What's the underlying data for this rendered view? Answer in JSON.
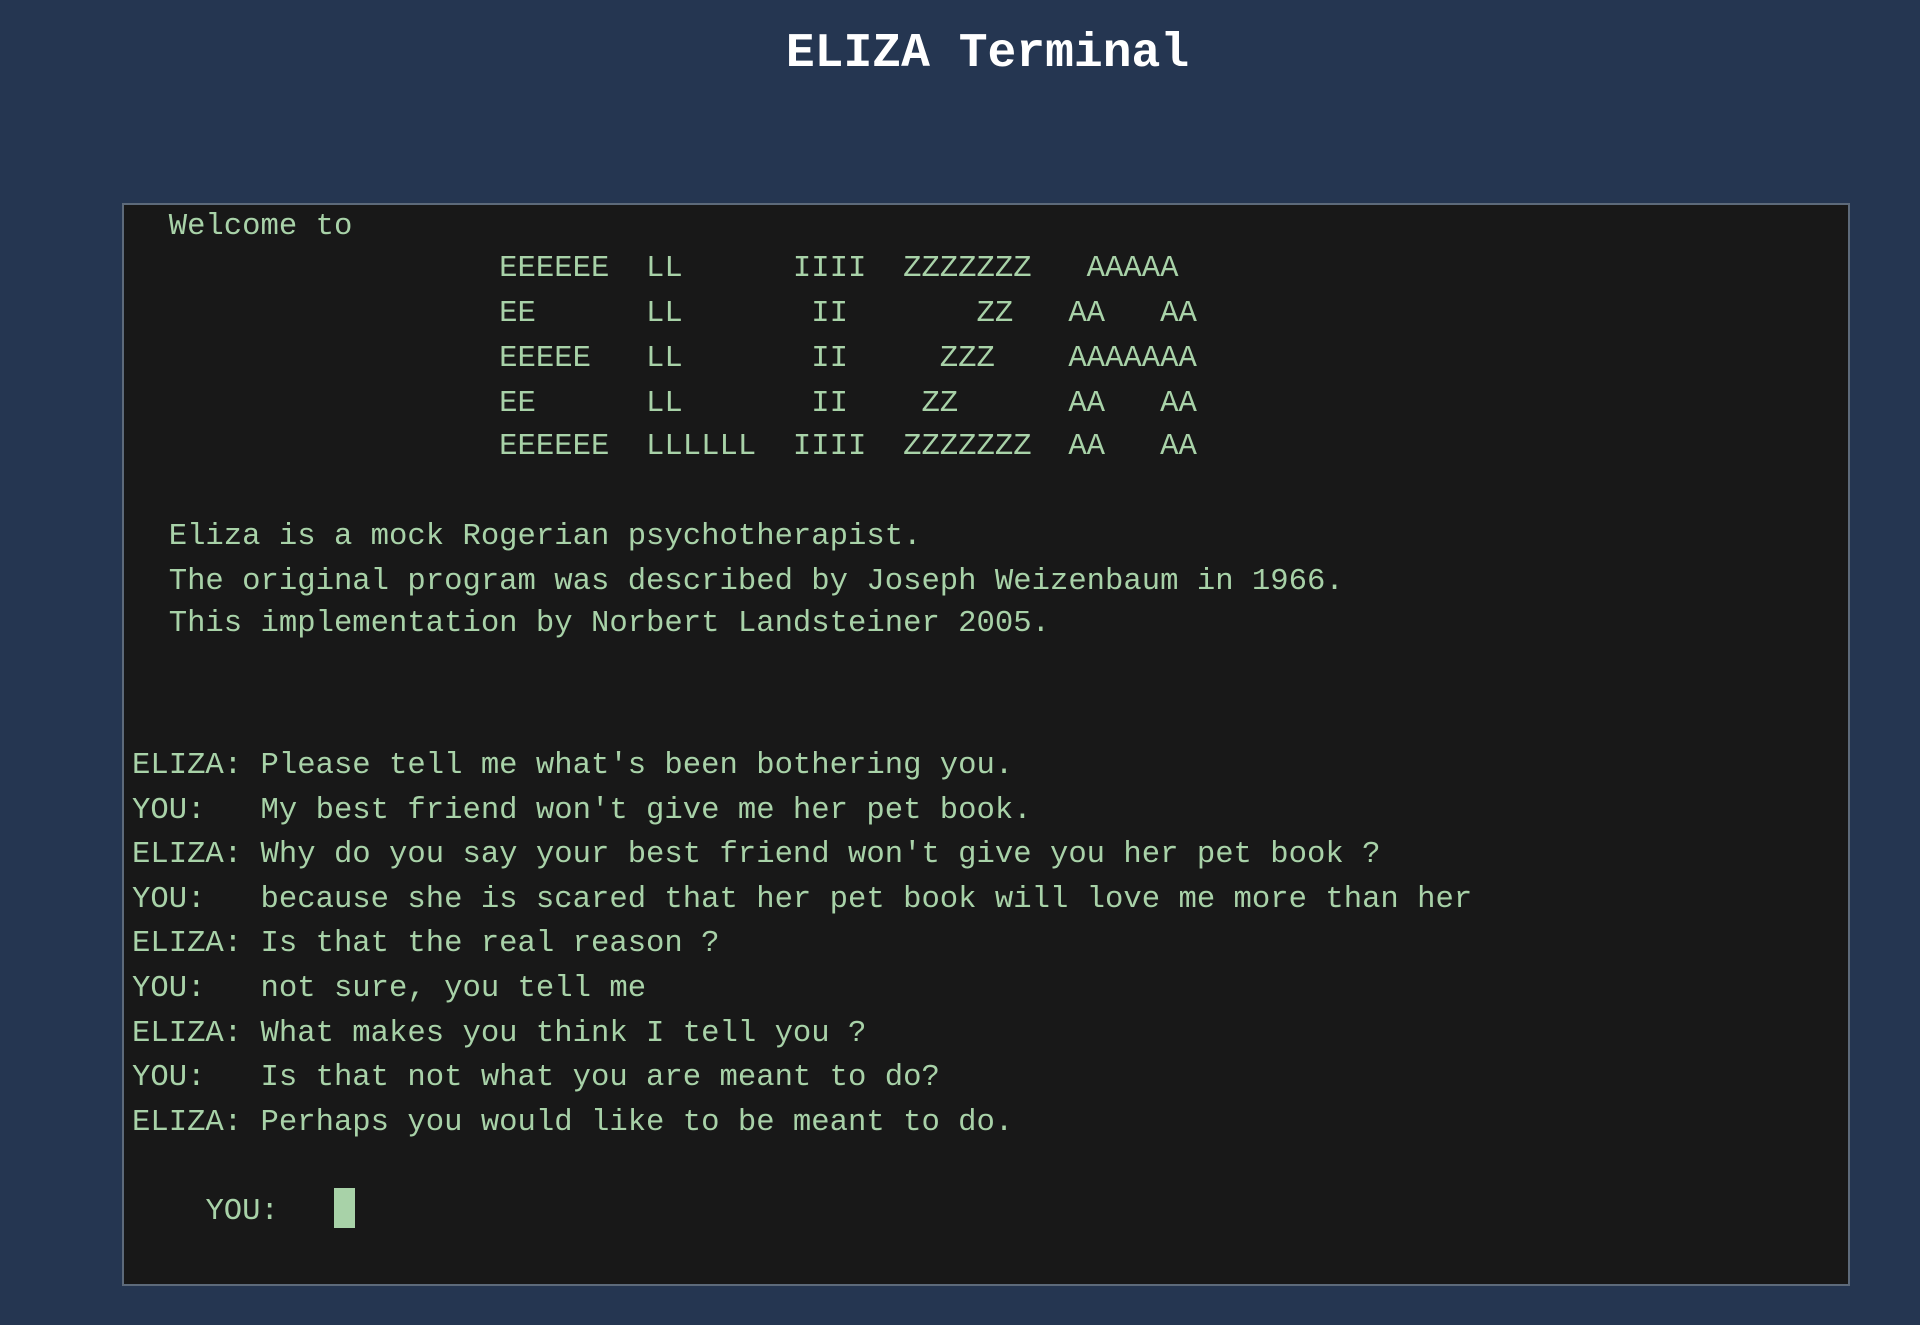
{
  "page": {
    "title": "ELIZA Terminal"
  },
  "terminal": {
    "banner": [
      "  Welcome to",
      "                    EEEEEE  LL      IIII  ZZZZZZZ   AAAAA",
      "                    EE      LL       II       ZZ   AA   AA",
      "                    EEEEE   LL       II     ZZZ    AAAAAAA",
      "                    EE      LL       II    ZZ      AA   AA",
      "                    EEEEEE  LLLLLL  IIII  ZZZZZZZ  AA   AA",
      "",
      "  Eliza is a mock Rogerian psychotherapist.",
      "  The original program was described by Joseph Weizenbaum in 1966.",
      "  This implementation by Norbert Landsteiner 2005."
    ],
    "conversation": [
      "ELIZA: Please tell me what's been bothering you.",
      "YOU:   My best friend won't give me her pet book.",
      "ELIZA: Why do you say your best friend won't give you her pet book ?",
      "YOU:   because she is scared that her pet book will love me more than her",
      "ELIZA: Is that the real reason ?",
      "YOU:   not sure, you tell me",
      "ELIZA: What makes you think I tell you ?",
      "YOU:   Is that not what you are meant to do?",
      "ELIZA: Perhaps you would like to be meant to do."
    ],
    "prompt_label": "YOU:   ",
    "input_value": ""
  },
  "colors": {
    "background": "#253651",
    "terminal_background": "#181818",
    "terminal_text": "#a8d2a8",
    "title_text": "#ffffff"
  }
}
